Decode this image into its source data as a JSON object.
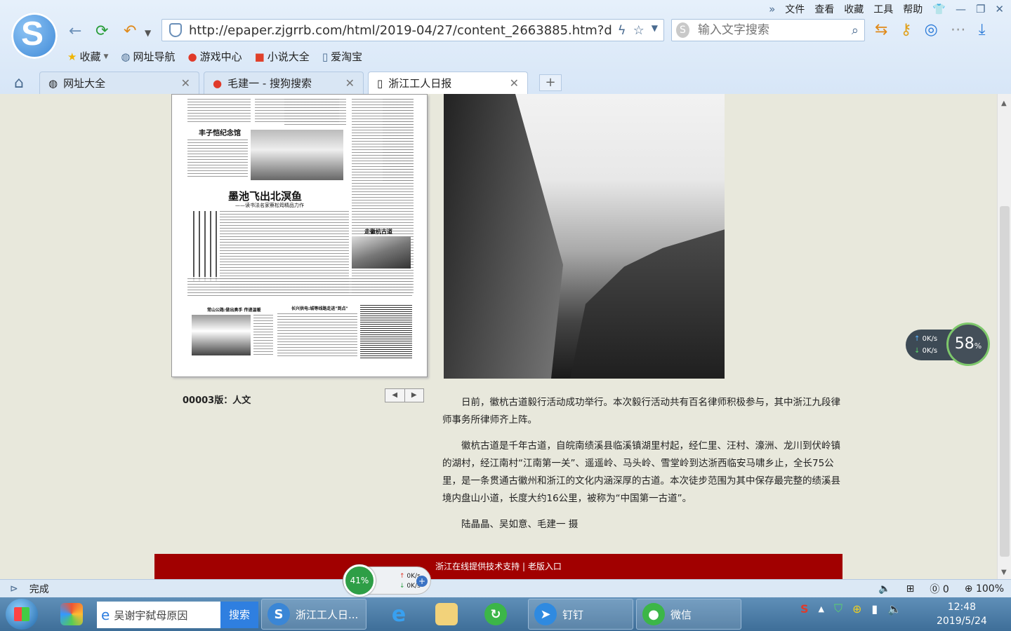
{
  "browser": {
    "menu": [
      "文件",
      "查看",
      "收藏",
      "工具",
      "帮助"
    ],
    "url": "http://epaper.zjgrrb.com/html/2019-04/27/content_2663885.htm?d",
    "search_placeholder": "输入文字搜索",
    "bookmarks": [
      {
        "label": "收藏",
        "icon": "star-icon"
      },
      {
        "label": "网址导航",
        "icon": "globe-icon"
      },
      {
        "label": "游戏中心",
        "icon": "sogou-icon"
      },
      {
        "label": "小说大全",
        "icon": "book-icon"
      },
      {
        "label": "爱淘宝",
        "icon": "page-icon"
      }
    ],
    "tabs": [
      {
        "label": "网址大全"
      },
      {
        "label": "毛建一 - 搜狗搜索"
      },
      {
        "label": "浙江工人日报"
      }
    ]
  },
  "newspaper": {
    "headline_1": "丰子恺纪念馆",
    "headline_2": "墨池飞出北溟鱼",
    "subhead_2": "——读书法名家蔡松筠精品力作",
    "headline_3": "走徽杭古道",
    "headline_4": "常山公路:做出奥手  传递温暖",
    "headline_5": "长兴供电:城等线路走进\"到点\"",
    "edition": "00003版：人文"
  },
  "article": {
    "paragraphs": [
      "日前，徽杭古道毅行活动成功举行。本次毅行活动共有百名律师积极参与，其中浙江九段律师事务所律师齐上阵。",
      "徽杭古道是千年古道，自皖南绩溪县临溪镇湖里村起，经仁里、汪村、濠洲、龙川到伏岭镇的湖村，经江南村“江南第一关”、遥遥岭、马头岭、雪堂岭到达浙西临安马啸乡止，全长75公里，是一条贯通古徽州和浙江的文化内涵深厚的古道。本次徒步范围为其中保存最完整的绩溪县境内盘山小道，长度大约16公里，被称为“中国第一古道”。",
      "陆晶晶、吴如意、毛建一 摄"
    ]
  },
  "footer": {
    "text": "浙江在线提供技术支持 | 老版入口"
  },
  "net_widget": {
    "up": "0K/s",
    "down": "0K/s",
    "percent": "58",
    "unit": "%"
  },
  "status": {
    "text": "完成",
    "count": "0",
    "zoom": "100%"
  },
  "mem_widget": {
    "percent": "41%",
    "up": "0K/s",
    "down": "0K/s"
  },
  "taskbar": {
    "search_text": "吴谢宇弑母原因",
    "search_button": "搜索",
    "items": [
      {
        "label": "浙江工人日..."
      },
      {
        "label": "钉钉"
      },
      {
        "label": "微信"
      }
    ],
    "time": "12:48",
    "date": "2019/5/24"
  },
  "colors": {
    "footer_bg": "#a10000",
    "page_bg": "#e8e8dc",
    "taskbar": "#3e6e98"
  }
}
